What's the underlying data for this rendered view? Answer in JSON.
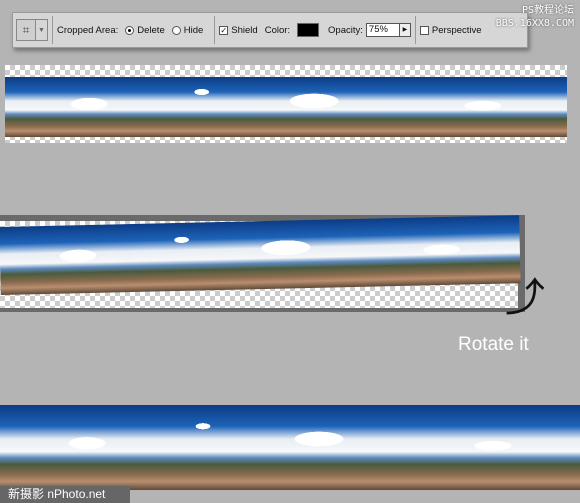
{
  "toolbar": {
    "tool_icon": "crop-icon",
    "cropped_area_label": "Cropped Area:",
    "delete_label": "Delete",
    "delete_selected": true,
    "hide_label": "Hide",
    "hide_selected": false,
    "shield_label": "Shield",
    "shield_checked": true,
    "color_label": "Color:",
    "shield_color": "#000000",
    "opacity_label": "Opacity:",
    "opacity_value": "75%",
    "perspective_label": "Perspective",
    "perspective_checked": false
  },
  "watermark": {
    "line1": "PS教程论坛",
    "line2": "BBS.16XX8.COM"
  },
  "annotation": {
    "text": "Rotate it",
    "arrow_icon": "curved-arrow-icon"
  },
  "credit": {
    "text": "新摄影 nPhoto.net"
  }
}
